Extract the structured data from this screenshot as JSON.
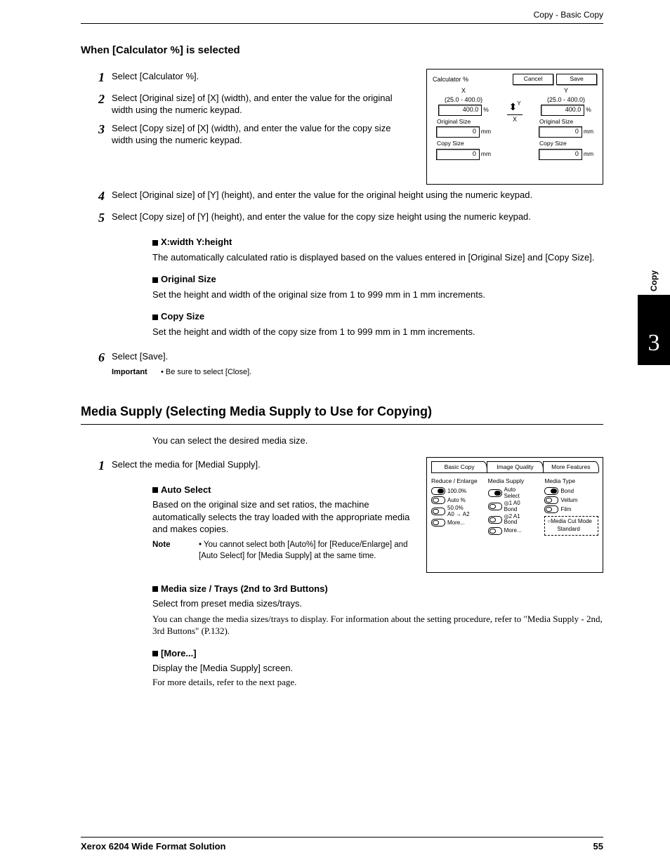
{
  "header": "Copy - Basic Copy",
  "section1": {
    "title": "When [Calculator %] is selected",
    "steps": [
      "Select [Calculator %].",
      "Select [Original size] of [X] (width), and enter the value for the original width using the numeric keypad.",
      "Select [Copy size] of [X] (width), and enter the value for the copy size width using the numeric keypad.",
      "Select [Original size] of [Y] (height), and enter the value for the original height using the numeric keypad.",
      "Select [Copy size] of [Y] (height), and enter the value for the copy size height using the numeric keypad."
    ],
    "detail1_h": "X:width  Y:height",
    "detail1_t": "The automatically calculated ratio is displayed based on the values entered in [Original Size] and [Copy Size].",
    "detail2_h": "Original Size",
    "detail2_t": "Set the height and width of the original size from 1 to 999 mm in 1 mm increments.",
    "detail3_h": "Copy Size",
    "detail3_t": "Set the height and width of the copy size from 1 to 999 mm in 1 mm increments.",
    "step6": "Select [Save].",
    "important_lbl": "Important",
    "important_txt": "• Be sure to select [Close]."
  },
  "screenshot1": {
    "title": "Calculator %",
    "cancel": "Cancel",
    "save": "Save",
    "x": "X",
    "y": "Y",
    "range": "(25.0 - 400.0)",
    "val": "400.0",
    "pct": "%",
    "orig": "Original Size",
    "zero": "0",
    "mm": "mm",
    "copy": "Copy Size",
    "centerX": "X",
    "centerY": "Y"
  },
  "section2": {
    "title": "Media Supply (Selecting Media Supply to Use for Copying)",
    "intro": "You can select the desired media size.",
    "step1": "Select the media for [Medial Supply].",
    "auto_h": "Auto Select",
    "auto_t": "Based on the original size and set ratios, the machine automatically selects the tray loaded with the appropriate media and makes copies.",
    "note_lbl": "Note",
    "note_txt": "• You cannot select both [Auto%] for [Reduce/Enlarge] and [Auto Select] for [Media Supply] at the same time.",
    "media_h": "Media size / Trays (2nd to 3rd Buttons)",
    "media_t": "Select from preset media sizes/trays.",
    "media_n": "You can change the media sizes/trays to display. For information about the setting procedure, refer to \"Media Supply - 2nd, 3rd Buttons\" (P.132).",
    "more_h": "[More...]",
    "more_t": "Display the [Media Supply] screen.",
    "more_n": "For more details, refer to the next page."
  },
  "screenshot2": {
    "tabs": [
      "Basic Copy",
      "Image Quality",
      "More Features"
    ],
    "col1_h": "Reduce /  Enlarge",
    "col1_o": [
      "100.0%",
      "Auto %",
      "50.0%\nA0 → A2",
      "More..."
    ],
    "col2_h": "Media Supply",
    "col2_o": [
      "Auto\nSelect",
      "◎1 A0\nBond",
      "◎2 A1\nBond",
      "More..."
    ],
    "col3_h": "Media Type",
    "col3_o": [
      "Bond",
      "Vellum",
      "Film"
    ],
    "cut_h": "Media Cut Mode",
    "cut_v": "Standard"
  },
  "sidebar": {
    "label": "Copy",
    "num": "3"
  },
  "footer": {
    "left": "Xerox 6204 Wide Format Solution",
    "right": "55"
  }
}
